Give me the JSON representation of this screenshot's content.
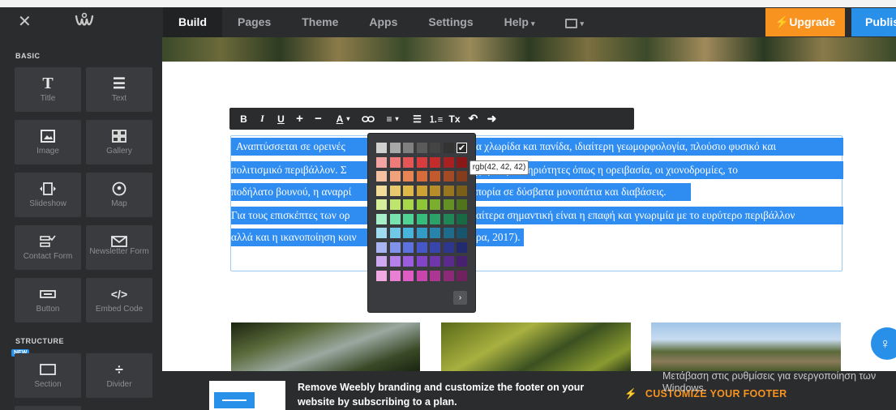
{
  "topbar": {
    "close_glyph": "✕",
    "nav": [
      {
        "label": "Build",
        "active": true
      },
      {
        "label": "Pages"
      },
      {
        "label": "Theme"
      },
      {
        "label": "Apps"
      },
      {
        "label": "Settings"
      },
      {
        "label": "Help"
      }
    ],
    "upgrade_label": "Upgrade",
    "publish_label": "Publish"
  },
  "sidebar": {
    "basic_label": "BASIC",
    "structure_label": "STRUCTURE",
    "new_badge": "NEW",
    "tiles": [
      {
        "label": "Title",
        "icon": "title-icon"
      },
      {
        "label": "Text",
        "icon": "text-icon"
      },
      {
        "label": "Image",
        "icon": "image-icon"
      },
      {
        "label": "Gallery",
        "icon": "gallery-icon"
      },
      {
        "label": "Slideshow",
        "icon": "slideshow-icon"
      },
      {
        "label": "Map",
        "icon": "map-icon"
      },
      {
        "label": "Contact Form",
        "icon": "contact-form-icon"
      },
      {
        "label": "Newsletter Form",
        "icon": "newsletter-icon"
      },
      {
        "label": "Button",
        "icon": "button-icon"
      },
      {
        "label": "Embed Code",
        "icon": "embed-code-icon"
      },
      {
        "label": "Section",
        "icon": "section-icon"
      },
      {
        "label": "Divider",
        "icon": "divider-icon"
      }
    ]
  },
  "toolbar": {
    "bold": "B",
    "italic": "I",
    "underline": "U",
    "plus": "+",
    "minus": "−",
    "color": "A",
    "clear": "Tx"
  },
  "content": {
    "line1": "Αναπτύσσεται σε ορεινές",
    "line1b": "α χλωρίδα και πανίδα, ιδιαίτερη γεωμορφολογία, πλούσιο φυσικό και",
    "line2": "πολιτισμικό περιβάλλον. Σ",
    "line2b": "χώρα δραστηριότητες όπως η ορειβασία, οι χιονοδρομίες, το",
    "line3": "ποδήλατο βουνού, η αναρρί",
    "line3b": "πορία σε δύσβατα μονοπάτια και διαβάσεις.",
    "line4": "Για τους επισκέπτες των ορ",
    "line4b": "αίτερα σημαντική είναι η επαφή και γνωριμία με το ευρύτερο περιβάλλον",
    "line5": "αλλά και η ικανοποίηση κοιν",
    "line5b": "ρα, 2017)."
  },
  "picker": {
    "tooltip": "rgb(42, 42, 42)",
    "check": "✔",
    "next": "›",
    "rows": [
      [
        "#d0d0d0",
        "#a8a8a8",
        "#808080",
        "#5a5a5a",
        "#444444",
        "#333333",
        "#2a2a2a"
      ],
      [
        "#f4a3a3",
        "#ee7a7a",
        "#e65555",
        "#d93c3c",
        "#c42b2b",
        "#a82020",
        "#8a1818"
      ],
      [
        "#f6c1a0",
        "#f0a27a",
        "#e98454",
        "#d86b3a",
        "#c35a2e",
        "#a34a24",
        "#853c1c"
      ],
      [
        "#f2dc9a",
        "#e9c96e",
        "#dfb84a",
        "#cda234",
        "#b68d28",
        "#98761f",
        "#7b5f18"
      ],
      [
        "#d8ef9a",
        "#bfe56e",
        "#a6d84a",
        "#8fc637",
        "#7aae2c",
        "#649124",
        "#4f741c"
      ],
      [
        "#a6efc9",
        "#78e3ae",
        "#4fd494",
        "#36bd7b",
        "#2ba268",
        "#218656",
        "#196a44"
      ],
      [
        "#9fdcef",
        "#71c8e6",
        "#48b3db",
        "#329cc6",
        "#2884aa",
        "#1f6b8c",
        "#17546e"
      ],
      [
        "#a8b5f2",
        "#8192ea",
        "#5d72df",
        "#4657c9",
        "#3846ac",
        "#2c378d",
        "#222b70"
      ],
      [
        "#cfa8f2",
        "#b480ea",
        "#9b5cdf",
        "#8444c9",
        "#7036ac",
        "#5b2a8d",
        "#472170"
      ],
      [
        "#f2a8e3",
        "#ea80d4",
        "#df5cc4",
        "#c944ad",
        "#ac3692",
        "#8d2a77",
        "#70215e"
      ]
    ]
  },
  "footer": {
    "message": "Remove Weebly branding and customize the footer on your website by subscribing to a plan.",
    "cta": "CUSTOMIZE YOUR FOOTER",
    "watermark": "Μετάβαση στις ρυθμίσεις για ενεργοποίηση των Windows."
  }
}
